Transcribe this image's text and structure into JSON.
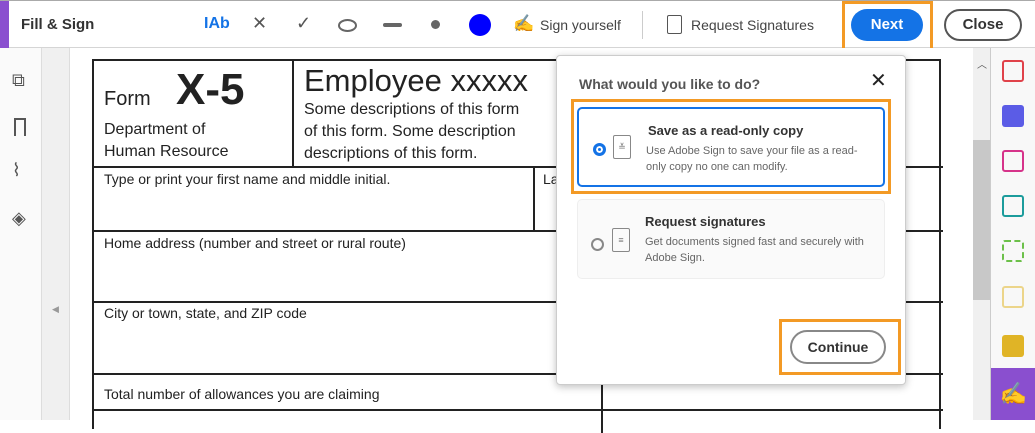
{
  "toolbar": {
    "title": "Fill & Sign",
    "text_tool": "IAb",
    "cross": "✕",
    "check": "✓",
    "sign_yourself": "Sign yourself",
    "request_signatures": "Request Signatures",
    "next": "Next",
    "close": "Close",
    "color": "#0000ff"
  },
  "form": {
    "form_label": "Form",
    "form_number": "X-5",
    "dept": "Department of",
    "dept2": "Human Resource",
    "title": "Employee xxxxx",
    "desc1": "Some descriptions of this form",
    "desc2": "of this form. Some description",
    "desc3": "descriptions of this form.",
    "first_name": "Type or print your first name and middle initial.",
    "last_name": "La",
    "address": "Home address (number and street or rural route)",
    "city": "City or town, state, and ZIP code",
    "allowances": "Total number of allowances you are claiming"
  },
  "dialog": {
    "heading": "What would you like to do?",
    "options": [
      {
        "title": "Save as a read-only copy",
        "desc": "Use Adobe Sign to save your file as a read-only copy no one can modify.",
        "selected": true
      },
      {
        "title": "Request signatures",
        "desc": "Get documents signed fast and securely with Adobe Sign.",
        "selected": false
      }
    ],
    "continue": "Continue"
  },
  "colors": {
    "accent": "#1473e6",
    "highlight": "#f39a25",
    "brand": "#8a4fcf"
  }
}
